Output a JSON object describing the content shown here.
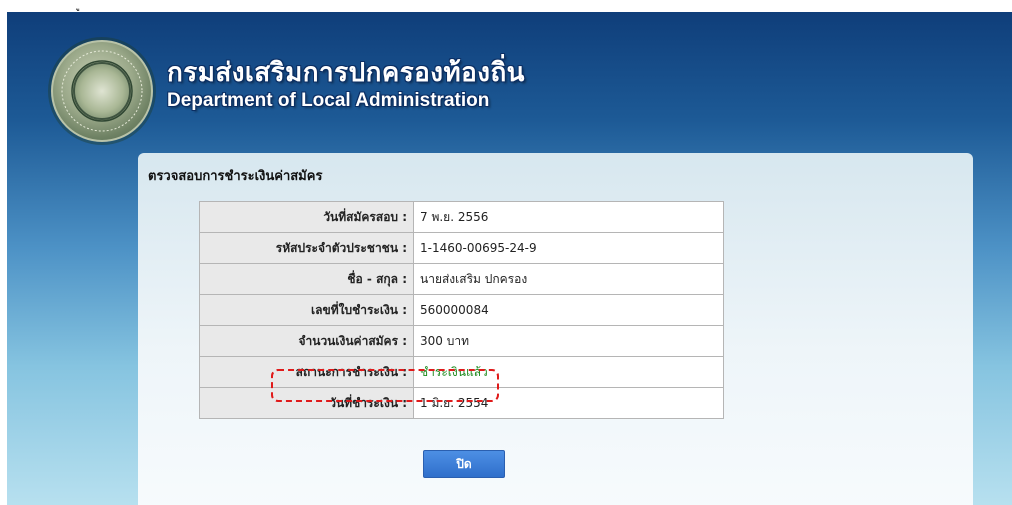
{
  "top_note": "ู",
  "header": {
    "title_th": "กรมส่งเสริมการปกครองท้องถิ่น",
    "title_en": "Department of Local Administration",
    "seal_icon": "dla-seal-icon"
  },
  "panel": {
    "title": "ตรวจสอบการชำระเงินค่าสมัคร",
    "rows": [
      {
        "label": "วันที่สมัครสอบ :",
        "value": "7 พ.ย. 2556"
      },
      {
        "label": "รหัสประจำตัวประชาชน :",
        "value": "1-1460-00695-24-9"
      },
      {
        "label": "ชื่อ - สกุล :",
        "value": "นายส่งเสริม ปกครอง"
      },
      {
        "label": "เลขที่ใบชำระเงิน :",
        "value": "560000084"
      },
      {
        "label": "จำนวนเงินค่าสมัคร :",
        "value": "300 บาท"
      },
      {
        "label": "สถานะการชำระเงิน :",
        "value": "ชำระเงินแล้ว"
      },
      {
        "label": "วันที่ชำระเงิน :",
        "value": "1 มิ.ย. 2554"
      }
    ],
    "close_label": "ปิด"
  },
  "colors": {
    "paid_status": "#1f8a1f",
    "highlight_dash": "#e01a1a",
    "button": "#3a7bd5"
  }
}
